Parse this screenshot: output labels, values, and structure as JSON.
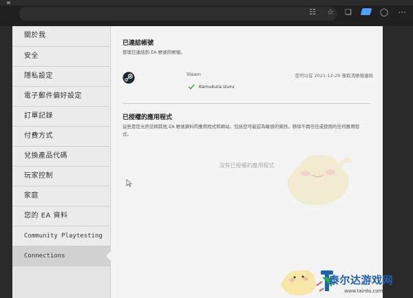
{
  "sidebar": {
    "items": [
      {
        "label": "關於我"
      },
      {
        "label": "安全"
      },
      {
        "label": "隱私設定"
      },
      {
        "label": "電子郵件偏好設定"
      },
      {
        "label": "訂單記錄"
      },
      {
        "label": "付費方式"
      },
      {
        "label": "兌換產品代碼"
      },
      {
        "label": "玩家控制"
      },
      {
        "label": "家庭"
      },
      {
        "label": "您的 EA 資料"
      },
      {
        "label": "Community Playtesting"
      },
      {
        "label": "Connections"
      }
    ]
  },
  "linked": {
    "title": "已連結帳號",
    "description": "管理已連結到 EA 帳號的帳號。",
    "account": {
      "service": "Steam",
      "username": "Kamukura Izuru",
      "date_note": "您可以在 2021-12-29 後取消帳號連結"
    }
  },
  "authorized": {
    "title": "已授權的應用程式",
    "description_line1": "這些是您允許訪問其他 EA 帳號資料的應用程式和網站，包括您可能認為敏感的資訊。移除不再信任或使用的任何應用程",
    "description_line2": "式。",
    "empty": "沒有已授權的應用程式"
  },
  "watermark": {
    "title": "泰尔达游戏网",
    "url": "www.tairda.com"
  },
  "colors": {
    "steam_blue": "#1b2838",
    "check_green": "#3c9a3c",
    "watermark_blue": "#1d5fb0"
  }
}
